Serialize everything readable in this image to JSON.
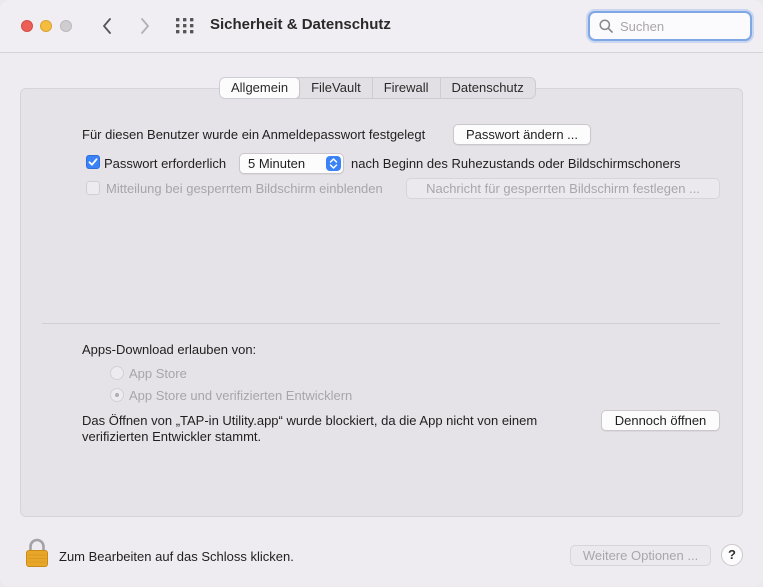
{
  "window": {
    "title": "Sicherheit & Datenschutz"
  },
  "search": {
    "placeholder": "Suchen",
    "value": ""
  },
  "tabs": [
    {
      "label": "Allgemein",
      "active": true
    },
    {
      "label": "FileVault",
      "active": false
    },
    {
      "label": "Firewall",
      "active": false
    },
    {
      "label": "Datenschutz",
      "active": false
    }
  ],
  "general": {
    "login_password_text": "Für diesen Benutzer wurde ein Anmeldepasswort festgelegt",
    "change_password_button": "Passwort ändern ...",
    "require_password": {
      "checked": true,
      "label": "Passwort erforderlich",
      "selected_delay": "5 Minuten",
      "suffix": "nach Beginn des Ruhezustands oder Bildschirmschoners"
    },
    "lock_message": {
      "checked": false,
      "enabled": false,
      "label": "Mitteilung bei gesperrtem Bildschirm einblenden",
      "button": "Nachricht für gesperrten Bildschirm festlegen ..."
    }
  },
  "downloads": {
    "heading": "Apps-Download erlauben von:",
    "options": [
      {
        "label": "App Store",
        "selected": false
      },
      {
        "label": "App Store und verifizierten Entwicklern",
        "selected": true
      }
    ],
    "blocked_line1": "Das Öffnen von „TAP-in Utility.app“ wurde blockiert, da die App nicht von einem",
    "blocked_line2": "verifizierten Entwickler stammt.",
    "open_anyway_button": "Dennoch öffnen"
  },
  "footer": {
    "lock_text": "Zum Bearbeiten auf das Schloss klicken.",
    "advanced_button": "Weitere Optionen ...",
    "help_label": "?"
  },
  "colors": {
    "accent": "#3a82f7",
    "close": "#ec5f57",
    "minimize": "#f4bd3f",
    "lock": "#e9a72a"
  }
}
